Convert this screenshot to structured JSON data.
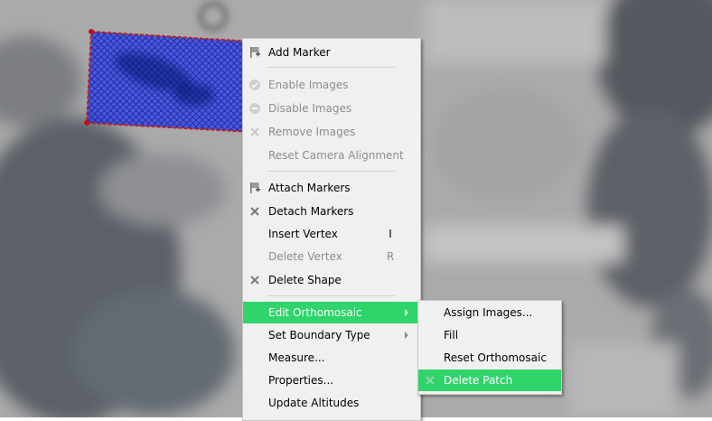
{
  "context_menu": {
    "items": [
      {
        "label": "Add Marker",
        "icon": "flag-plus-icon",
        "enabled": true
      },
      {
        "label": "Enable Images",
        "icon": "check-circle-icon",
        "enabled": false
      },
      {
        "label": "Disable Images",
        "icon": "minus-circle-icon",
        "enabled": false
      },
      {
        "label": "Remove Images",
        "icon": "x-icon",
        "enabled": false
      },
      {
        "label": "Reset Camera Alignment",
        "enabled": false
      },
      {
        "label": "Attach Markers",
        "icon": "flag-plus-icon",
        "enabled": true
      },
      {
        "label": "Detach Markers",
        "icon": "x-icon",
        "enabled": true
      },
      {
        "label": "Insert Vertex",
        "shortcut": "I",
        "enabled": true
      },
      {
        "label": "Delete Vertex",
        "shortcut": "R",
        "enabled": false
      },
      {
        "label": "Delete Shape",
        "icon": "x-icon",
        "enabled": true
      },
      {
        "label": "Edit Orthomosaic",
        "submenu": true,
        "highlighted": true
      },
      {
        "label": "Set Boundary Type",
        "submenu": true
      },
      {
        "label": "Measure..."
      },
      {
        "label": "Properties..."
      },
      {
        "label": "Update Altitudes"
      }
    ]
  },
  "submenu": {
    "items": [
      {
        "label": "Assign Images..."
      },
      {
        "label": "Fill"
      },
      {
        "label": "Reset Orthomosaic"
      },
      {
        "label": "Delete Patch",
        "icon": "x-icon",
        "highlighted": true
      }
    ]
  },
  "colors": {
    "highlight": "#2fd46a",
    "menu_bg": "#f0f0f0",
    "patch_fill": "#2a3cf0",
    "patch_border": "#b82020"
  }
}
